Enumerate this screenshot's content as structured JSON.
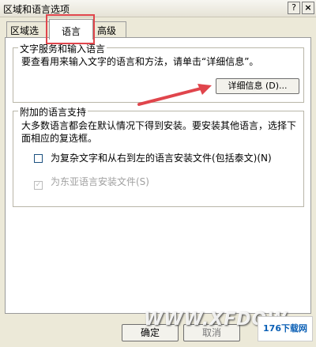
{
  "window": {
    "title": "区域和语言选项",
    "help_glyph": "?",
    "close_glyph": "×"
  },
  "tabs": [
    {
      "label": "区域选项"
    },
    {
      "label": "语言"
    },
    {
      "label": "高级"
    }
  ],
  "text_services": {
    "legend": "文字服务和输入语言",
    "description": "要查看用来输入文字的语言和方法，请单击“详细信息”。",
    "details_button": "详细信息 (D)..."
  },
  "supplemental": {
    "legend": "附加的语言支持",
    "description": "大多数语言都会在默认情况下得到安装。要安装其他语言，选择下面相应的复选框。",
    "checkbox1": {
      "label": "为复杂文字和从右到左的语言安装文件(包括泰文)(N)",
      "checked": false
    },
    "checkbox2": {
      "label": "为东亚语言安装文件(S)",
      "checked": true,
      "disabled": true,
      "mark": "✓"
    }
  },
  "buttons": {
    "ok": "确定",
    "cancel": "取消"
  },
  "watermark": {
    "text": "WWW.XFDOW",
    "badge": "176下载网"
  },
  "colors": {
    "annotation_red": "#e0454c"
  }
}
